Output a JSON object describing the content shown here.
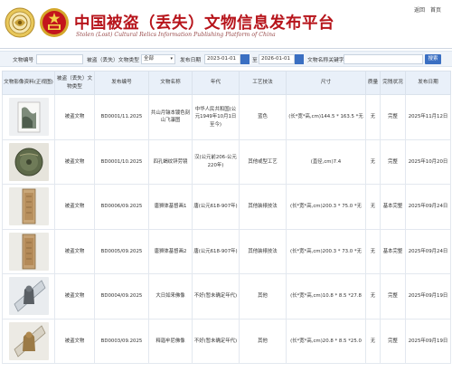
{
  "header": {
    "title_cn": "中国被盗（丢失）文物信息发布平台",
    "title_en": "Stolen (Lost) Cultural Relics Information Publishing Platform of China",
    "links": [
      "返回",
      "首页"
    ]
  },
  "search": {
    "code_label": "文物编号",
    "type_label": "被盗（丢失）文物类型",
    "type_value": "全部",
    "date_label": "发布日期",
    "date_from": "2023-01-01",
    "date_to": "2026-01-01",
    "to_label": "至",
    "keyword_label": "文物名称关键字",
    "search_button": "搜索"
  },
  "table": {
    "headers": [
      "文物影像资料(正视图)",
      "被盗（丢失）文物类型",
      "发布编号",
      "文物名称",
      "年代",
      "工艺技法",
      "尺寸",
      "质量",
      "完残状况",
      "发布日期"
    ],
    "rows": [
      {
        "type": "被盗文物",
        "code": "BD0001/11.2025",
        "name": "共山月镶本镀色刻山飞瀑图",
        "era": "中华人民共和国(公元1949年10月1日至今)",
        "craft": "蓝色",
        "size": "(长*宽*高,cm)144.5 * 163.5 *无",
        "quality": "无",
        "condition": "完整",
        "date": "2025年11月12日"
      },
      {
        "type": "被盗文物",
        "code": "BD0001/10.2025",
        "name": "四孔蝎纹锌劳镜",
        "era": "汉(公元前206-公元220年)",
        "craft": "其他或型工艺",
        "size": "(直径,cm)7.4",
        "quality": "无",
        "condition": "完整",
        "date": "2025年10月20日"
      },
      {
        "type": "被盗文物",
        "code": "BD0006/09.2025",
        "name": "唐狮体基督画1",
        "era": "唐(公元618-907年)",
        "craft": "其他装裱技法",
        "size": "(长*宽*高,cm)200.3 * 75.0 *无",
        "quality": "无",
        "condition": "基本完整",
        "date": "2025年09月24日"
      },
      {
        "type": "被盗文物",
        "code": "BD0005/09.2025",
        "name": "唐狮体基督画2",
        "era": "唐(公元618-907年)",
        "craft": "其他装裱技法",
        "size": "(长*宽*高,cm)200.3 * 73.0 *无",
        "quality": "无",
        "condition": "基本完整",
        "date": "2025年09月24日"
      },
      {
        "type": "被盗文物",
        "code": "BD0004/09.2025",
        "name": "大日如来佛像",
        "era": "不好(暂未确定年代)",
        "craft": "其他",
        "size": "(长*宽*高,cm)10.8 * 8.5 *27.8",
        "quality": "无",
        "condition": "完整",
        "date": "2025年09月19日"
      },
      {
        "type": "被盗文物",
        "code": "BD0003/09.2025",
        "name": "释迦牟尼佛像",
        "era": "不好(暂未确定年代)",
        "craft": "其他",
        "size": "(长*宽*高,cm)20.8 * 8.5 *25.0",
        "quality": "无",
        "condition": "完整",
        "date": "2025年09月19日"
      }
    ]
  },
  "colors": {
    "title": "#b7141b",
    "link": "#2b58b8",
    "header_bg": "#e9f0f9",
    "button": "#3a6fc2"
  }
}
